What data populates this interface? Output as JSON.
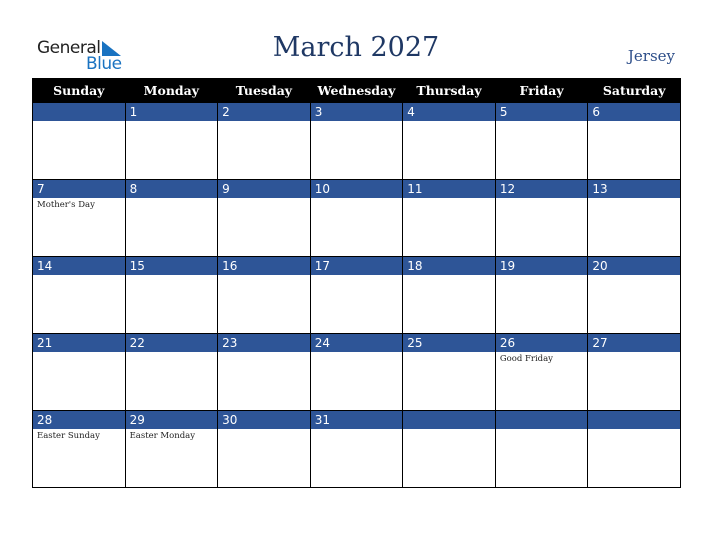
{
  "logo": {
    "line1": "General",
    "line2": "Blue",
    "brand_color": "#1a73c1"
  },
  "header": {
    "title": "March 2027",
    "region": "Jersey"
  },
  "colors": {
    "header_bg": "#000000",
    "band_bg": "#2e5597",
    "title_color": "#1f3864"
  },
  "weekdays": [
    "Sunday",
    "Monday",
    "Tuesday",
    "Wednesday",
    "Thursday",
    "Friday",
    "Saturday"
  ],
  "weeks": [
    [
      {
        "day": "",
        "event": ""
      },
      {
        "day": "1",
        "event": ""
      },
      {
        "day": "2",
        "event": ""
      },
      {
        "day": "3",
        "event": ""
      },
      {
        "day": "4",
        "event": ""
      },
      {
        "day": "5",
        "event": ""
      },
      {
        "day": "6",
        "event": ""
      }
    ],
    [
      {
        "day": "7",
        "event": "Mother's Day"
      },
      {
        "day": "8",
        "event": ""
      },
      {
        "day": "9",
        "event": ""
      },
      {
        "day": "10",
        "event": ""
      },
      {
        "day": "11",
        "event": ""
      },
      {
        "day": "12",
        "event": ""
      },
      {
        "day": "13",
        "event": ""
      }
    ],
    [
      {
        "day": "14",
        "event": ""
      },
      {
        "day": "15",
        "event": ""
      },
      {
        "day": "16",
        "event": ""
      },
      {
        "day": "17",
        "event": ""
      },
      {
        "day": "18",
        "event": ""
      },
      {
        "day": "19",
        "event": ""
      },
      {
        "day": "20",
        "event": ""
      }
    ],
    [
      {
        "day": "21",
        "event": ""
      },
      {
        "day": "22",
        "event": ""
      },
      {
        "day": "23",
        "event": ""
      },
      {
        "day": "24",
        "event": ""
      },
      {
        "day": "25",
        "event": ""
      },
      {
        "day": "26",
        "event": "Good Friday"
      },
      {
        "day": "27",
        "event": ""
      }
    ],
    [
      {
        "day": "28",
        "event": "Easter Sunday"
      },
      {
        "day": "29",
        "event": "Easter Monday"
      },
      {
        "day": "30",
        "event": ""
      },
      {
        "day": "31",
        "event": ""
      },
      {
        "day": "",
        "event": ""
      },
      {
        "day": "",
        "event": ""
      },
      {
        "day": "",
        "event": ""
      }
    ]
  ]
}
